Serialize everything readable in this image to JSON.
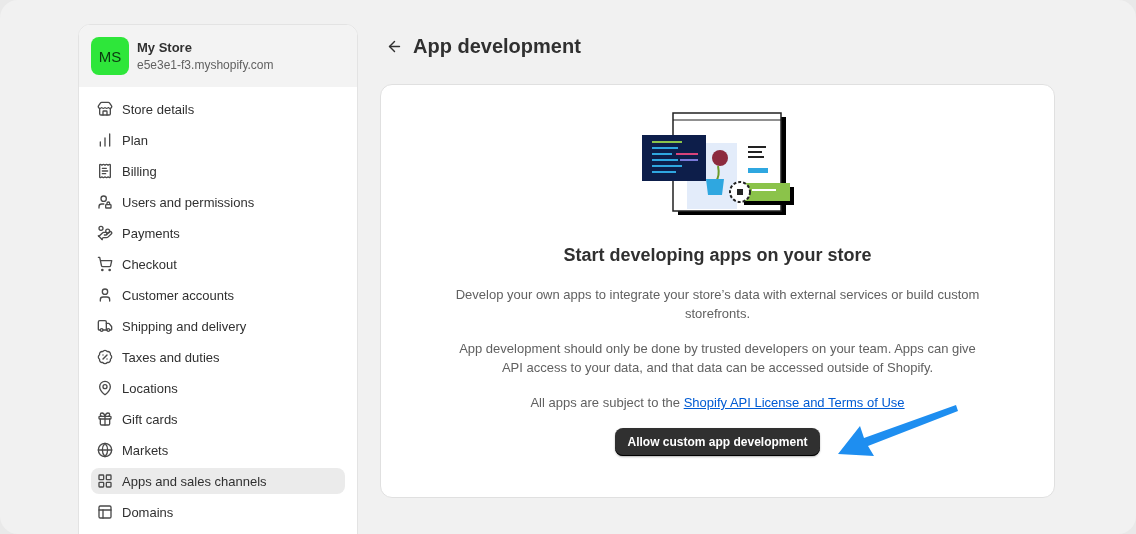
{
  "store": {
    "initials": "MS",
    "name": "My Store",
    "domain": "e5e3e1-f3.myshopify.com"
  },
  "sidebar": {
    "items": [
      {
        "label": "Store details",
        "selected": false
      },
      {
        "label": "Plan",
        "selected": false
      },
      {
        "label": "Billing",
        "selected": false
      },
      {
        "label": "Users and permissions",
        "selected": false
      },
      {
        "label": "Payments",
        "selected": false
      },
      {
        "label": "Checkout",
        "selected": false
      },
      {
        "label": "Customer accounts",
        "selected": false
      },
      {
        "label": "Shipping and delivery",
        "selected": false
      },
      {
        "label": "Taxes and duties",
        "selected": false
      },
      {
        "label": "Locations",
        "selected": false
      },
      {
        "label": "Gift cards",
        "selected": false
      },
      {
        "label": "Markets",
        "selected": false
      },
      {
        "label": "Apps and sales channels",
        "selected": true
      },
      {
        "label": "Domains",
        "selected": false
      }
    ]
  },
  "page": {
    "title": "App development"
  },
  "card": {
    "heading": "Start developing apps on your store",
    "paragraphs": [
      "Develop your own apps to integrate your store’s data with external services or build custom storefronts.",
      "App development should only be done by trusted developers on your team. Apps can give API access to your data, and that data can be accessed outside of Shopify."
    ],
    "terms": {
      "text": "All apps are subject to the ",
      "link": "Shopify API License and Terms of Use"
    },
    "button": "Allow custom app development"
  }
}
